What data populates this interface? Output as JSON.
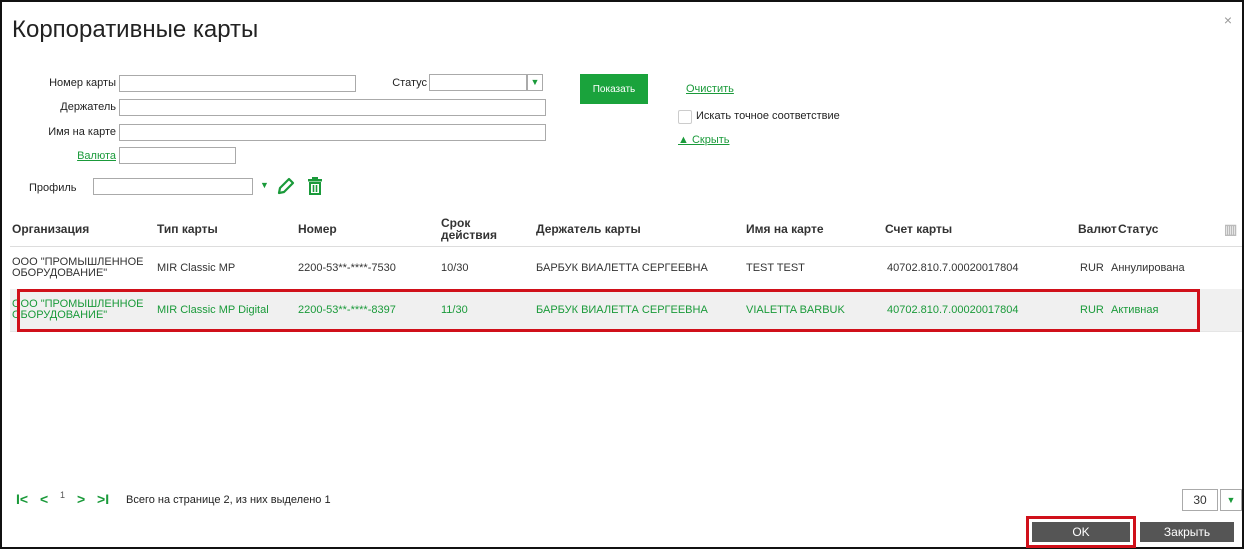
{
  "title": "Корпоративные карты",
  "close": "×",
  "filters": {
    "card_number_label": "Номер карты",
    "card_number_value": "",
    "status_label": "Статус",
    "status_value": "",
    "holder_label": "Держатель",
    "holder_value": "",
    "name_on_card_label": "Имя на карте",
    "name_on_card_value": "",
    "currency_label": "Валюта",
    "currency_value": "",
    "profile_label": "Профиль",
    "profile_value": "",
    "show_button": "Показать",
    "clear_link": "Очистить",
    "exact_match_label": "Искать точное соответствие",
    "hide_link": "▲ Скрыть"
  },
  "table": {
    "headers": [
      "Организация",
      "Тип карты",
      "Номер",
      "Срок действия",
      "Держатель карты",
      "Имя на карте",
      "Счет карты",
      "Валют",
      "Статус"
    ],
    "rows": [
      [
        "ООО \"ПРОМЫШЛЕННОЕ ОБОРУДОВАНИЕ\"",
        "MIR Classic MP",
        "2200-53**-****-7530",
        "10/30",
        "БАРБУК ВИАЛЕТТА СЕРГЕЕВНА",
        "TEST TEST",
        "40702.810.7.00020017804",
        "RUR",
        "Аннулирована"
      ],
      [
        "ООО \"ПРОМЫШЛЕННОЕ ОБОРУДОВАНИЕ\"",
        "MIR Classic MP Digital",
        "2200-53**-****-8397",
        "11/30",
        "БАРБУК ВИАЛЕТТА СЕРГЕЕВНА",
        "VIALETTA BARBUK",
        "40702.810.7.00020017804",
        "RUR",
        "Активная"
      ]
    ],
    "selected_row": 1
  },
  "pager": {
    "first": "I<",
    "prev": "<",
    "page": "1",
    "next": ">",
    "last": ">I",
    "info": "Всего на странице 2, из них выделено 1",
    "per_page": "30"
  },
  "buttons": {
    "ok": "OK",
    "close": "Закрыть"
  },
  "colors": {
    "accent": "#1aa33c",
    "highlight": "#d0101a"
  }
}
